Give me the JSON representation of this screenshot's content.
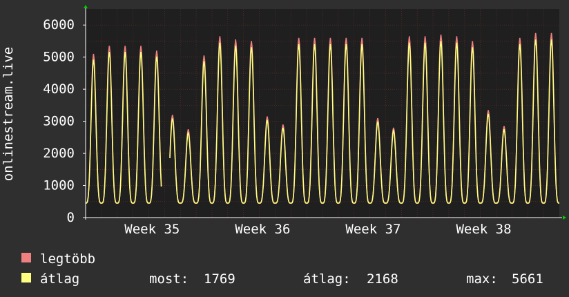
{
  "chart_data": {
    "type": "line",
    "ylabel": "onlinestream.live",
    "yticks": [
      "0",
      "1000",
      "2000",
      "3000",
      "4000",
      "5000",
      "6000"
    ],
    "ylim": [
      0,
      6500
    ],
    "grid": true,
    "x_ticks": [
      "Week 35",
      "Week 36",
      "Week 37",
      "Week 38"
    ],
    "x_days": 30,
    "x_tick_days": [
      2.2,
      9.2,
      16.2,
      23.2
    ],
    "day_offset": 0.0,
    "daily_peaks": [
      5100,
      5350,
      5350,
      5350,
      5200,
      3200,
      2750,
      5050,
      5650,
      5550,
      5500,
      3150,
      2900,
      5600,
      5600,
      5600,
      5600,
      5600,
      3100,
      2800,
      5650,
      5650,
      5700,
      5650,
      5500,
      3350,
      2850,
      5600,
      5750
    ],
    "daily_min": 450,
    "gap_days": [
      4.8,
      5.3
    ],
    "series": [
      {
        "name": "legtöbb",
        "color": "#f08080"
      },
      {
        "name": "átlag",
        "color": "#ffff80"
      }
    ],
    "stats": {
      "now_label": "most:",
      "now_value": "1769",
      "avg_label": "átlag:",
      "avg_value": "2168",
      "max_label": "max:",
      "max_value": "5661"
    },
    "colors": {
      "background": "#2f2f2f",
      "plot_background": "#1f1f1f",
      "grid": "#c0383a",
      "axis_arrow": "#00cc00"
    }
  }
}
